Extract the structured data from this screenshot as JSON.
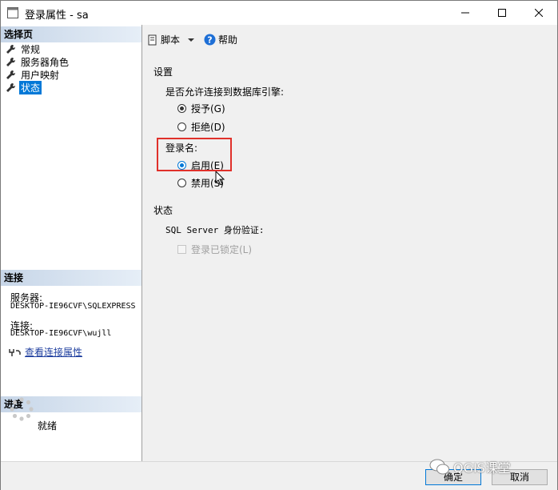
{
  "window": {
    "title": "登录属性 - sa"
  },
  "sidebar": {
    "select_page_header": "选择页",
    "items": [
      {
        "label": "常规"
      },
      {
        "label": "服务器角色"
      },
      {
        "label": "用户映射"
      },
      {
        "label": "状态"
      }
    ],
    "connection_header": "连接",
    "server_label": "服务器:",
    "server_value": "DESKTOP-IE96CVF\\SQLEXPRESS",
    "connection_label": "连接:",
    "connection_value": "DESKTOP-IE96CVF\\wujll",
    "view_connection_link": "查看连接属性",
    "progress_header": "进度",
    "progress_status": "就绪"
  },
  "toolbar": {
    "script_label": "脚本",
    "help_label": "帮助"
  },
  "settings": {
    "header": "设置",
    "permission_question": "是否允许连接到数据库引擎:",
    "grant_label": "授予(G)",
    "deny_label": "拒绝(D)",
    "login_header": "登录名:",
    "enable_label": "启用(E)",
    "disable_label": "禁用(S)"
  },
  "status": {
    "header": "状态",
    "sql_auth_label": "SQL Server 身份验证:",
    "locked_label": "登录已锁定(L)"
  },
  "footer": {
    "ok_label": "确定",
    "cancel_label": "取消"
  },
  "watermark": {
    "text": "QGIS课堂"
  },
  "state": {
    "permission_selected": "grant",
    "login_selected": "enable",
    "active_page": "状态",
    "locked_checked": false
  },
  "colors": {
    "accent": "#0078d7",
    "highlight_box": "#e0302a",
    "section_header": "#c7d6e8",
    "link": "#1f3f9f"
  }
}
